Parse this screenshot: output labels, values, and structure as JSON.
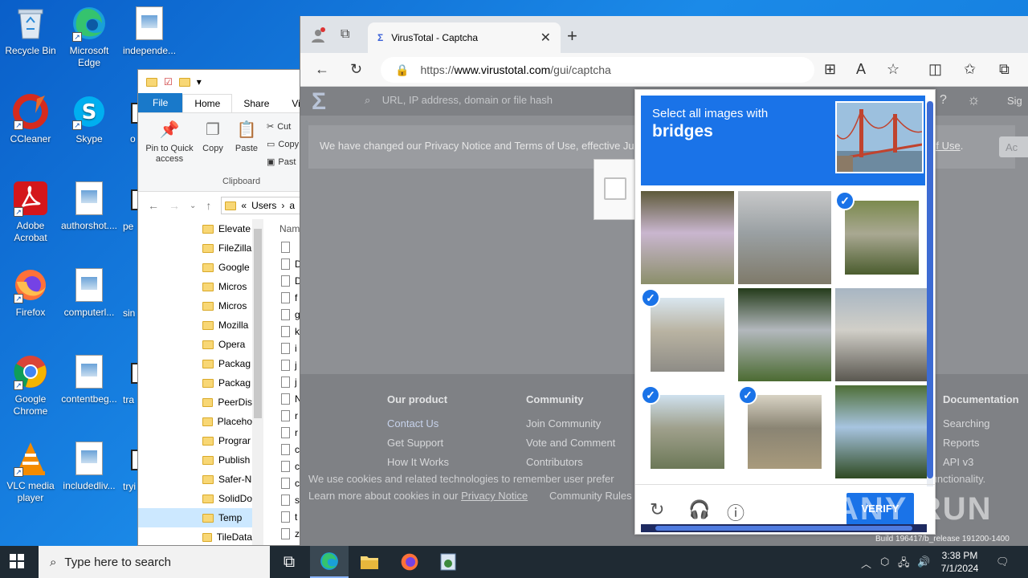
{
  "desktop": {
    "icons": [
      {
        "label": "Recycle Bin",
        "icon": "recycle-bin-icon"
      },
      {
        "label": "Microsoft Edge",
        "icon": "edge-icon"
      },
      {
        "label": "independe...",
        "icon": "document-icon"
      },
      {
        "label": "CCleaner",
        "icon": "ccleaner-icon"
      },
      {
        "label": "Skype",
        "icon": "skype-icon"
      },
      {
        "label": "Adobe Acrobat",
        "icon": "acrobat-icon"
      },
      {
        "label": "authorshot....",
        "icon": "document-icon"
      },
      {
        "label": "Firefox",
        "icon": "firefox-icon"
      },
      {
        "label": "computerl...",
        "icon": "document-icon"
      },
      {
        "label": "Google Chrome",
        "icon": "chrome-icon"
      },
      {
        "label": "contentbeg...",
        "icon": "document-icon"
      },
      {
        "label": "VLC media player",
        "icon": "vlc-icon"
      },
      {
        "label": "includedliv...",
        "icon": "document-icon"
      }
    ],
    "partials": [
      "o",
      "pe",
      "sin",
      "tra",
      "tryi"
    ]
  },
  "explorer": {
    "ribbon_tabs": [
      "File",
      "Home",
      "Share",
      "Vie"
    ],
    "buttons": {
      "pin": "Pin to Quick access",
      "copy": "Copy",
      "paste": "Paste",
      "cut": "Cut",
      "copy_path": "Copy",
      "paste_shortcut": "Past"
    },
    "group": "Clipboard",
    "address": [
      "«",
      "Users",
      "›",
      "a"
    ],
    "column_header": "Nam",
    "nav_items": [
      "Elevate",
      "FileZilla",
      "Google",
      "Micros",
      "Micros",
      "Mozilla",
      "Opera",
      "Packag",
      "Packag",
      "PeerDis",
      "Placeho",
      "Prograr",
      "Publish",
      "Safer-N",
      "SolidDo",
      "Temp",
      "TileData"
    ],
    "selected_nav": "Temp",
    "file_rows": [
      "",
      "D",
      "D",
      "f",
      "g",
      "k",
      "i",
      "j",
      "j",
      "N",
      "r",
      "r",
      "c",
      "c",
      "c",
      "s",
      "t",
      "z"
    ]
  },
  "browser": {
    "tab_title": "VirusTotal - Captcha",
    "url_prefix": "https://",
    "url_domain": "www.virustotal.com",
    "url_path": "/gui/captcha",
    "search_placeholder": "URL, IP address, domain or file hash",
    "notice": "We have changed our Privacy Notice and Terms of Use, effective Ju",
    "notice_link": "s of Use",
    "notice_end": ".",
    "sign": "Sig",
    "accept": "Ac",
    "footer": {
      "col1": {
        "heading": "Our product",
        "links": [
          "Contact Us",
          "Get Support",
          "How It Works"
        ]
      },
      "col2": {
        "heading": "Community",
        "links": [
          "Join Community",
          "Vote and Comment",
          "Contributors"
        ]
      },
      "col3": {
        "heading": "Documentation",
        "links": [
          "Searching",
          "Reports",
          "API v3"
        ]
      }
    },
    "cookie_line1": "We use cookies and related technologies to remember user prefer",
    "cookie_line1_end": "functionality.",
    "cookie_line2": "Learn more about cookies in our",
    "cookie_link": "Privacy Notice",
    "cookie_tail": "Community Rules",
    "build": "Build 196417/b_release 191200-1400"
  },
  "captcha": {
    "prompt": "Select all images with",
    "target": "bridges",
    "selected": [
      2,
      3,
      6,
      7
    ],
    "verify": "VERIFY",
    "footer_icons": [
      "reload-icon",
      "audio-icon",
      "info-icon"
    ]
  },
  "watermark": "ANY RUN",
  "taskbar": {
    "search_placeholder": "Type here to search",
    "time": "3:38 PM",
    "date": "7/1/2024"
  }
}
